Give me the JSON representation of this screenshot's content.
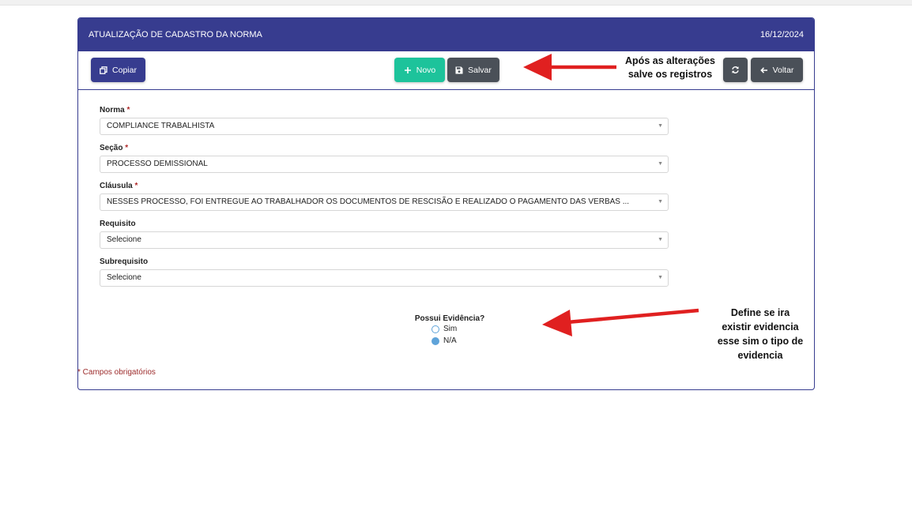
{
  "header": {
    "title": "ATUALIZAÇÃO DE CADASTRO DA NORMA",
    "date": "16/12/2024"
  },
  "toolbar": {
    "copy_label": "Copiar",
    "new_label": "Novo",
    "save_label": "Salvar",
    "back_label": "Voltar"
  },
  "form": {
    "norma": {
      "label": "Norma",
      "value": "COMPLIANCE TRABALHISTA"
    },
    "secao": {
      "label": "Seção",
      "value": "PROCESSO DEMISSIONAL"
    },
    "clausula": {
      "label": "Cláusula",
      "value": "NESSES PROCESSO, FOI ENTREGUE AO TRABALHADOR OS DOCUMENTOS DE RESCISÃO E REALIZADO O PAGAMENTO DAS VERBAS ..."
    },
    "requisito": {
      "label": "Requisito",
      "value": "Selecione"
    },
    "subrequisito": {
      "label": "Subrequisito",
      "value": "Selecione"
    },
    "required_mark": "*"
  },
  "evidence": {
    "title": "Possui Evidência?",
    "options": [
      {
        "label": "Sim",
        "selected": false
      },
      {
        "label": "N/A",
        "selected": true
      }
    ]
  },
  "required_note": "* Campos obrigatórios",
  "annotations": {
    "save_note_line1": "Após as alterações",
    "save_note_line2": "salve os registros",
    "evidence_note_line1": "Define se ira",
    "evidence_note_line2": "existir evidencia",
    "evidence_note_line3": "esse sim o tipo de",
    "evidence_note_line4": "evidencia"
  },
  "colors": {
    "primary": "#373c8f",
    "success": "#1dc39b",
    "secondary": "#4a5058",
    "arrow": "#e02020"
  }
}
